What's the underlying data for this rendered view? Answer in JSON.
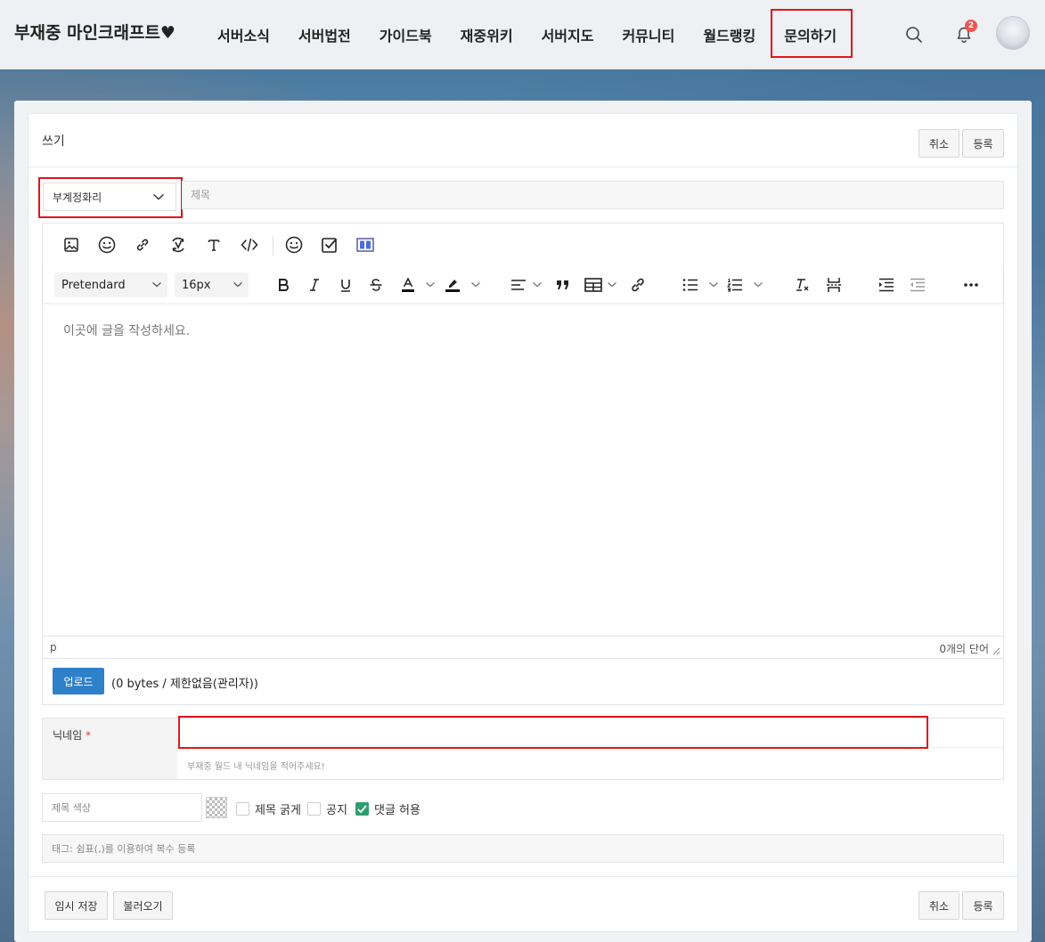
{
  "header": {
    "logo": "부재중 마인크래프트♥",
    "nav": [
      "서버소식",
      "서버법전",
      "가이드북",
      "재중위키",
      "서버지도",
      "커뮤니티",
      "월드랭킹",
      "문의하기"
    ],
    "active_nav": "문의하기",
    "notification_count": "2"
  },
  "form": {
    "write_label": "쓰기",
    "cancel_label": "취소",
    "submit_label": "등록",
    "category_selected": "부계정화리",
    "title_placeholder": "제목"
  },
  "editor": {
    "font_family": "Pretendard",
    "font_size": "16px",
    "placeholder": "이곳에 글을 작성하세요.",
    "status_tag": "p",
    "word_count": "0개의 단어"
  },
  "upload": {
    "button_label": "업로드",
    "info": "(0 bytes / 제한없음(관리자))"
  },
  "nickname": {
    "label": "닉네임",
    "required_mark": "*",
    "value": "",
    "help": "부재중 월드 내 닉네임을 적어주세요!"
  },
  "options": {
    "title_color_placeholder": "제목 색상",
    "bold_title": "제목 굵게",
    "notice": "공지",
    "allow_comments": "댓글 허용",
    "allow_comments_checked": true,
    "tags_placeholder": "태그: 쉼표(,)를 이용하여 복수 등록"
  },
  "footer": {
    "temp_save": "임시 저장",
    "load": "불러오기",
    "cancel": "취소",
    "submit": "등록"
  },
  "colors": {
    "accent_red": "#e0161c",
    "upload_blue": "#2e80c9",
    "check_green": "#2f9e6e"
  }
}
